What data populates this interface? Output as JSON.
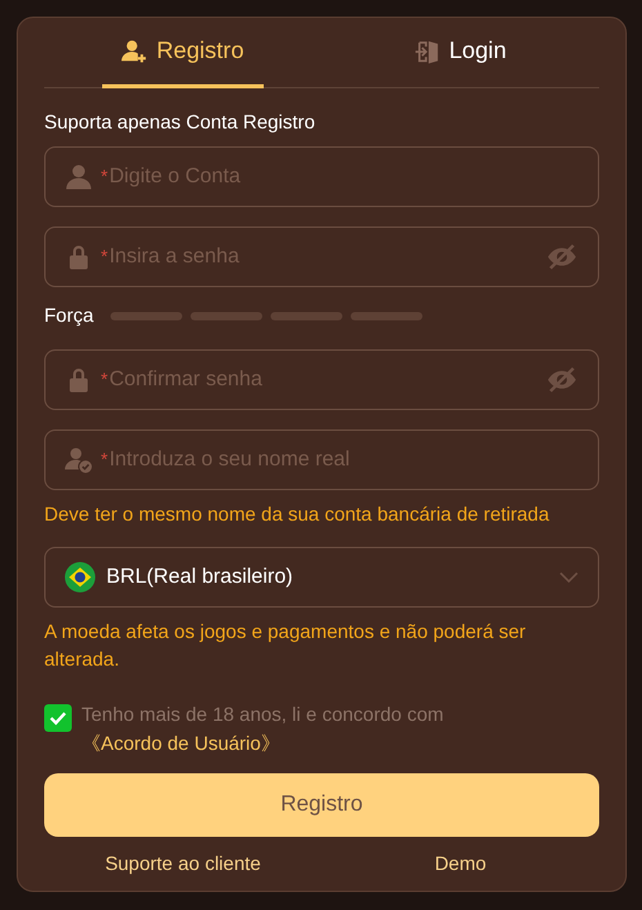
{
  "tabs": [
    {
      "label": "Registro",
      "kind": "register",
      "selected": true
    },
    {
      "label": "Login",
      "kind": "login",
      "selected": false
    }
  ],
  "notice": "Suporta apenas Conta Registro",
  "fields": [
    {
      "kind": "account",
      "required_mark": "*",
      "placeholder": "Digite o Conta",
      "toggle_visibility": false
    },
    {
      "kind": "password",
      "required_mark": "*",
      "placeholder": "Insira a senha",
      "toggle_visibility": true
    },
    {
      "kind": "strength",
      "label": "Força",
      "segments": [
        {
          "lit": false
        },
        {
          "lit": false
        },
        {
          "lit": false
        },
        {
          "lit": false
        }
      ]
    },
    {
      "kind": "password",
      "required_mark": "*",
      "placeholder": "Confirmar senha",
      "toggle_visibility": true
    },
    {
      "kind": "realname",
      "required_mark": "*",
      "placeholder": "Introduza o seu nome real",
      "toggle_visibility": false
    },
    {
      "kind": "hint",
      "text": "Deve ter o mesmo nome da sua conta bancária de retirada"
    },
    {
      "kind": "currency",
      "value": "BRL(Real brasileiro)"
    },
    {
      "kind": "hint",
      "text": "A moeda afeta os jogos e pagamentos e não poderá ser alterada."
    }
  ],
  "agreement": {
    "checked": true,
    "text": "Tenho mais de 18 anos, li e concordo com",
    "link": "《Acordo de Usuário》"
  },
  "submit": "Registro",
  "footer_links": [
    "Suporte ao cliente",
    "Demo"
  ]
}
